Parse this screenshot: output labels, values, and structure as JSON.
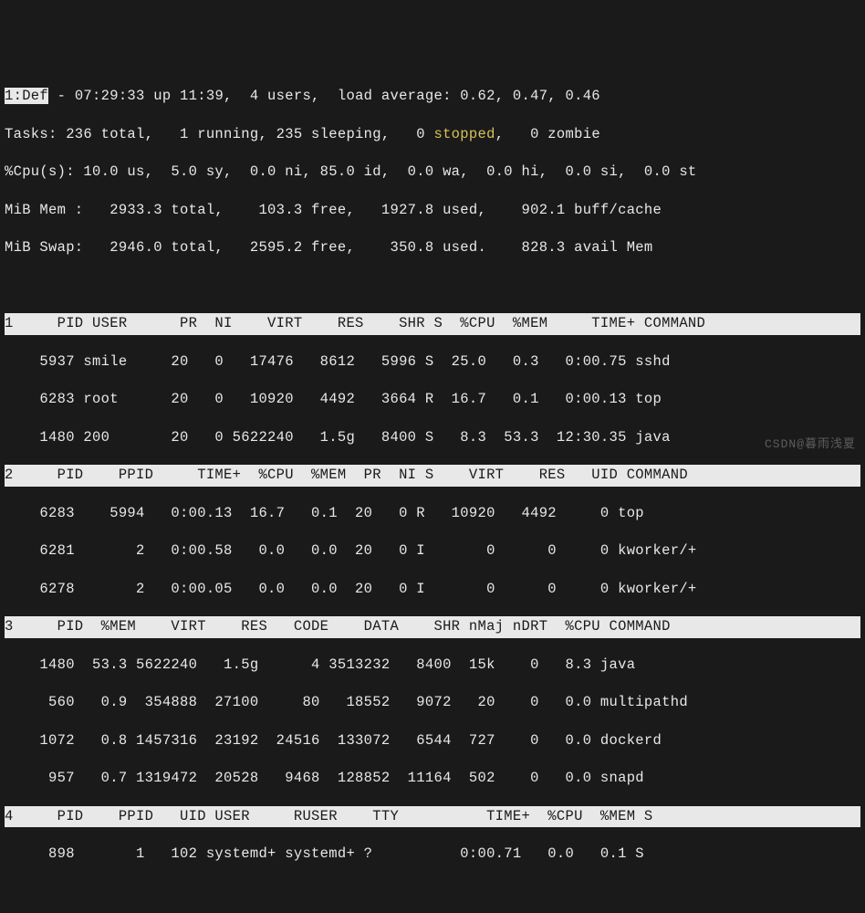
{
  "summary": {
    "win_label": "1:Def",
    "uptime_line": " - 07:29:33 up 11:39,  4 users,  load average: 0.62, 0.47, 0.46",
    "tasks_a": "Tasks: 236 total,   1 running, 235 sleeping,   0 ",
    "tasks_stopped": "stopped",
    "tasks_b": ",   0 zombie",
    "cpu": "%Cpu(s): 10.0 us,  5.0 sy,  0.0 ni, 85.0 id,  0.0 wa,  0.0 hi,  0.0 si,  0.0 st",
    "mem": "MiB Mem :   2933.3 total,    103.3 free,   1927.8 used,    902.1 buff/cache",
    "swap": "MiB Swap:   2946.0 total,   2595.2 free,    350.8 used.    828.3 avail Mem"
  },
  "hdr1": "1     PID USER      PR  NI    VIRT    RES    SHR S  %CPU  %MEM     TIME+ COMMAND         ",
  "p1": {
    "r0": "    5937 smile     20   0   17476   8612   5996 S  25.0   0.3   0:00.75 sshd",
    "r1": "    6283 root      20   0   10920   4492   3664 R  16.7   0.1   0:00.13 top",
    "r2": "    1480 200       20   0 5622240   1.5g   8400 S   8.3  53.3  12:30.35 java"
  },
  "hdr2": "2     PID    PPID     TIME+  %CPU  %MEM  PR  NI S    VIRT    RES   UID COMMAND           ",
  "p2": {
    "r0": "    6283    5994   0:00.13  16.7   0.1  20   0 R   10920   4492     0 top",
    "r1": "    6281       2   0:00.58   0.0   0.0  20   0 I       0      0     0 kworker/+",
    "r2": "    6278       2   0:00.05   0.0   0.0  20   0 I       0      0     0 kworker/+"
  },
  "hdr3": "3     PID  %MEM    VIRT    RES   CODE    DATA    SHR nMaj nDRT  %CPU COMMAND             ",
  "p3": {
    "r0": "    1480  53.3 5622240   1.5g      4 3513232   8400  15k    0   8.3 java",
    "r1": "     560   0.9  354888  27100     80   18552   9072   20    0   0.0 multipathd",
    "r2": "    1072   0.8 1457316  23192  24516  133072   6544  727    0   0.0 dockerd",
    "r3": "     957   0.7 1319472  20528   9468  128852  11164  502    0   0.0 snapd"
  },
  "hdr4": "4     PID    PPID   UID USER     RUSER    TTY          TIME+  %CPU  %MEM S               ",
  "p4": {
    "r0": "     898       1   102 systemd+ systemd+ ?          0:00.71   0.0   0.1 S"
  },
  "watermark": "CSDN@暮雨浅夏"
}
